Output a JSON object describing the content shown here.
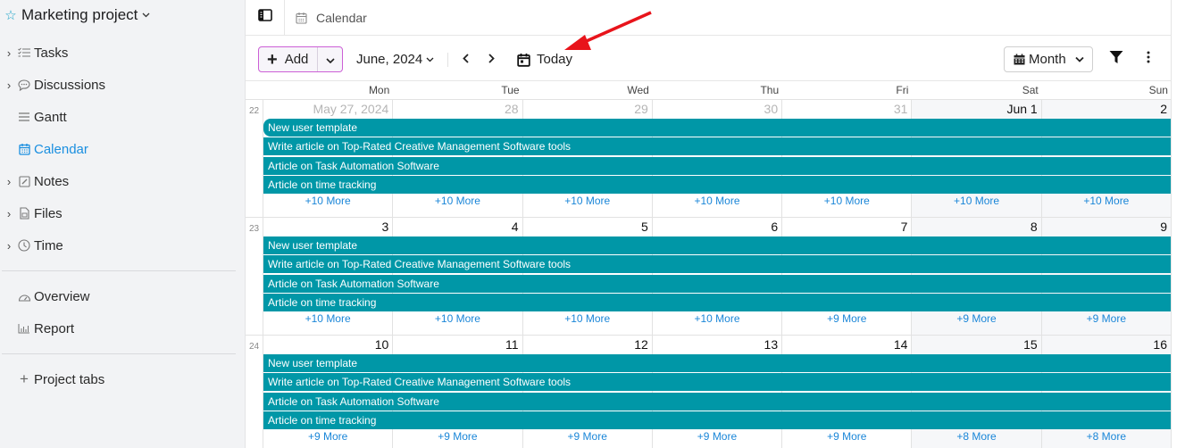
{
  "sidebar": {
    "project_title": "Marketing project",
    "items": [
      {
        "label": "Tasks",
        "icon": "task-list-icon",
        "expandable": true,
        "active": false
      },
      {
        "label": "Discussions",
        "icon": "chat-bubble-icon",
        "expandable": true,
        "active": false
      },
      {
        "label": "Gantt",
        "icon": "gantt-icon",
        "expandable": false,
        "active": false
      },
      {
        "label": "Calendar",
        "icon": "calendar-icon",
        "expandable": false,
        "active": true
      },
      {
        "label": "Notes",
        "icon": "note-icon",
        "expandable": true,
        "active": false
      },
      {
        "label": "Files",
        "icon": "file-icon",
        "expandable": true,
        "active": false
      },
      {
        "label": "Time",
        "icon": "clock-icon",
        "expandable": true,
        "active": false
      }
    ],
    "secondary_items": [
      {
        "label": "Overview",
        "icon": "gauge-icon"
      },
      {
        "label": "Report",
        "icon": "bar-chart-icon"
      }
    ],
    "add_tabs_label": "Project tabs"
  },
  "topbar": {
    "breadcrumb": "Calendar"
  },
  "toolbar": {
    "add_label": "Add",
    "month_label": "June, 2024",
    "today_label": "Today",
    "view_label": "Month"
  },
  "colors": {
    "event": "#0097a7",
    "active_nav": "#1a8fe0",
    "add_border": "#cc5fd6",
    "more_link": "#1a86d8",
    "annotation_arrow": "#e8141b"
  },
  "calendar": {
    "weekdays": [
      "Mon",
      "Tue",
      "Wed",
      "Thu",
      "Fri",
      "Sat",
      "Sun"
    ],
    "weeks": [
      {
        "week_number": "22",
        "days": [
          {
            "label": "May 27, 2024",
            "other_month": true,
            "more": "+10 More"
          },
          {
            "label": "28",
            "other_month": true,
            "more": "+10 More"
          },
          {
            "label": "29",
            "other_month": true,
            "more": "+10 More"
          },
          {
            "label": "30",
            "other_month": true,
            "more": "+10 More"
          },
          {
            "label": "31",
            "other_month": true,
            "more": "+10 More"
          },
          {
            "label": "Jun 1",
            "other_month": false,
            "more": "+10 More"
          },
          {
            "label": "2",
            "other_month": false,
            "more": "+10 More"
          }
        ],
        "events": [
          "New user template",
          "Write article on Top-Rated Creative Management Software tools",
          "Article on Task Automation Software",
          "Article on time tracking"
        ]
      },
      {
        "week_number": "23",
        "days": [
          {
            "label": "3",
            "other_month": false,
            "more": "+10 More"
          },
          {
            "label": "4",
            "other_month": false,
            "more": "+10 More"
          },
          {
            "label": "5",
            "other_month": false,
            "more": "+10 More"
          },
          {
            "label": "6",
            "other_month": false,
            "more": "+10 More"
          },
          {
            "label": "7",
            "other_month": false,
            "more": "+9 More"
          },
          {
            "label": "8",
            "other_month": false,
            "more": "+9 More"
          },
          {
            "label": "9",
            "other_month": false,
            "more": "+9 More"
          }
        ],
        "events": [
          "New user template",
          "Write article on Top-Rated Creative Management Software tools",
          "Article on Task Automation Software",
          "Article on time tracking"
        ]
      },
      {
        "week_number": "24",
        "days": [
          {
            "label": "10",
            "other_month": false,
            "more": "+9 More"
          },
          {
            "label": "11",
            "other_month": false,
            "more": "+9 More"
          },
          {
            "label": "12",
            "other_month": false,
            "more": "+9 More"
          },
          {
            "label": "13",
            "other_month": false,
            "more": "+9 More"
          },
          {
            "label": "14",
            "other_month": false,
            "more": "+9 More"
          },
          {
            "label": "15",
            "other_month": false,
            "more": "+8 More"
          },
          {
            "label": "16",
            "other_month": false,
            "more": "+8 More"
          }
        ],
        "events": [
          "New user template",
          "Write article on Top-Rated Creative Management Software tools",
          "Article on Task Automation Software",
          "Article on time tracking"
        ]
      }
    ]
  }
}
